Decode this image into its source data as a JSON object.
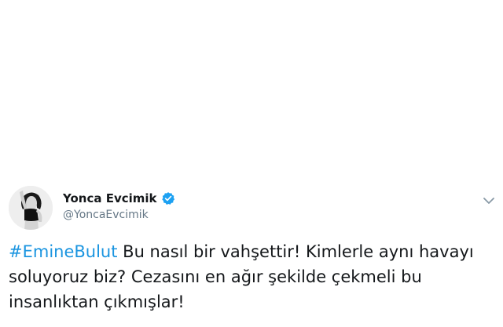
{
  "tweet": {
    "display_name": "Yonca Evcimik",
    "handle": "@YoncaEvcimik",
    "verified": true,
    "hashtag": "#EmineBulut",
    "text_line1_rest": " Bu nasıl bir vahşettir! Kimlerle aynı havayı",
    "text_line2": "soluyoruz biz? Cezasını en ağır şekilde çekmeli bu",
    "text_line3": "insanlıktan çıkmışlar!"
  },
  "colors": {
    "hashtag": "#1b95e0",
    "verified_badge": "#1da1f2",
    "handle": "#657786",
    "text": "#14171a"
  },
  "icons": {
    "verified": "verified-badge-icon",
    "menu": "chevron-down-icon",
    "avatar": "profile-photo"
  }
}
